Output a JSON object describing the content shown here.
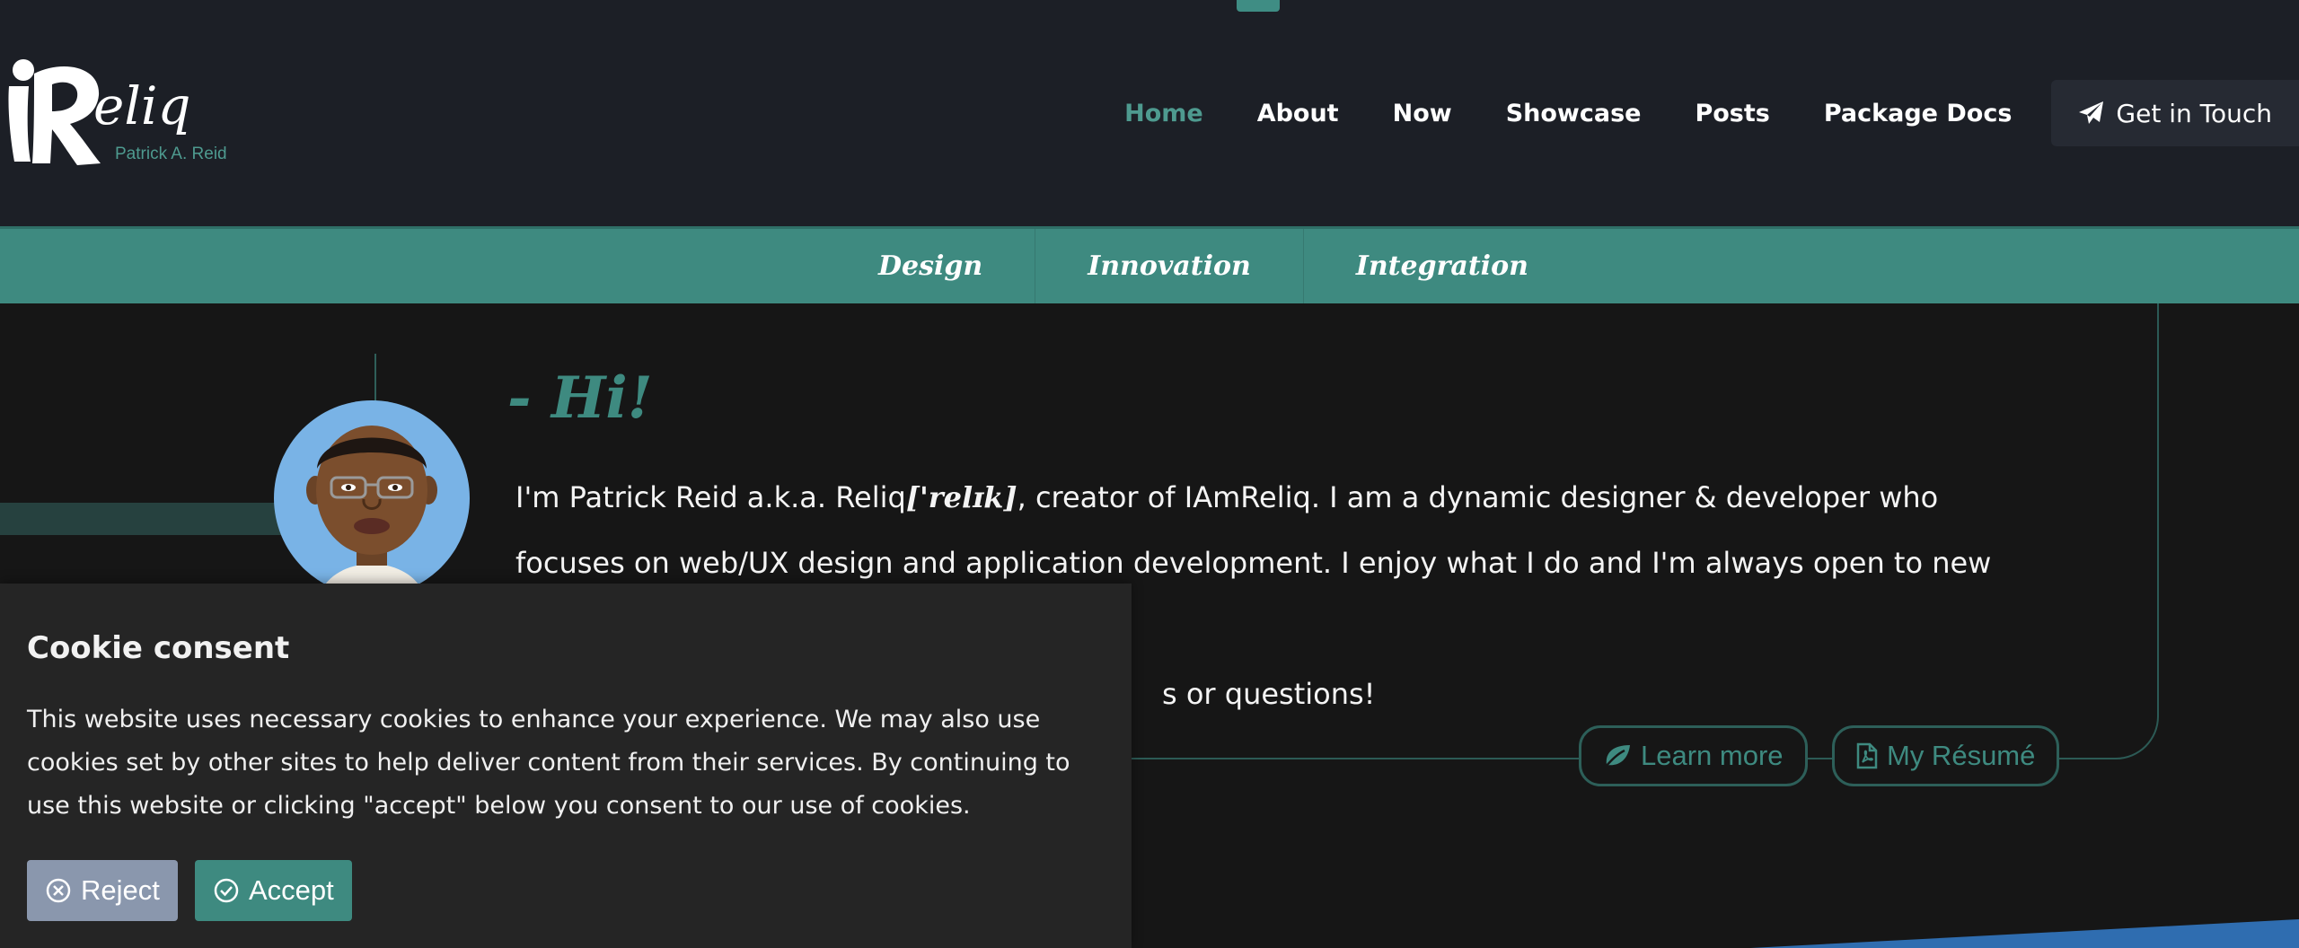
{
  "colors": {
    "accent": "#3e8a80",
    "header_bg": "#1c1f26",
    "page_bg": "#161616",
    "cookie_bg": "#252525",
    "reject_bg": "#8a97ad",
    "avatar_bg": "#79b3e6",
    "wedge": "#2f6db0"
  },
  "logo": {
    "wordmark": "iReliq",
    "subtitle": "Patrick A. Reid"
  },
  "nav": {
    "items": [
      {
        "label": "Home",
        "active": true
      },
      {
        "label": "About",
        "active": false
      },
      {
        "label": "Now",
        "active": false
      },
      {
        "label": "Showcase",
        "active": false
      },
      {
        "label": "Posts",
        "active": false
      },
      {
        "label": "Package Docs",
        "active": false
      }
    ],
    "cta": {
      "label": "Get in Touch",
      "icon": "paper-plane-icon"
    }
  },
  "tagline": {
    "items": [
      "Design",
      "Innovation",
      "Integration"
    ]
  },
  "hero": {
    "greeting": "- Hi!",
    "intro_before": "I'm Patrick Reid a.k.a. Reliq",
    "pronunciation": "['relɪk]",
    "intro_after": ", creator of IAmReliq. I am a dynamic designer & developer who focuses on web/UX design and application development. I enjoy what I do and I'm always open to new ideas. Feel free to",
    "intro_tail": "s or questions!",
    "buttons": {
      "learn_more": {
        "label": "Learn more",
        "icon": "leaf-icon"
      },
      "resume": {
        "label": "My Résumé",
        "icon": "pdf-file-icon"
      }
    }
  },
  "cookie": {
    "title": "Cookie consent",
    "text": "This website uses necessary cookies to enhance your experience. We may also use cookies set by other sites to help deliver content from their services. By continuing to use this website or clicking \"accept\" below you consent to our use of cookies.",
    "reject": {
      "label": "Reject",
      "icon": "x-circle-icon"
    },
    "accept": {
      "label": "Accept",
      "icon": "check-circle-icon"
    }
  }
}
